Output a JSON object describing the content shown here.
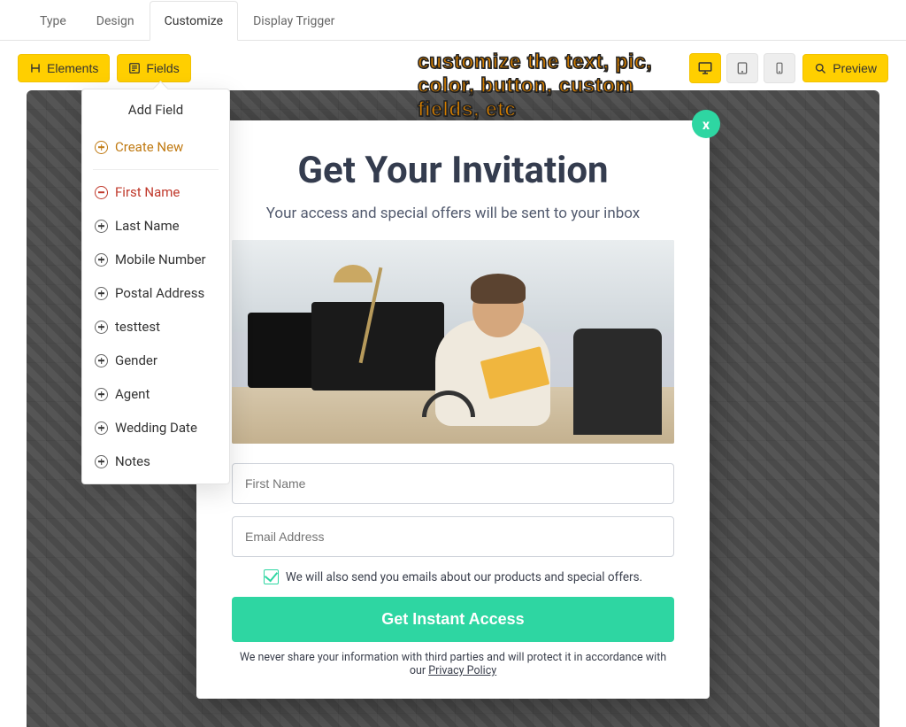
{
  "tabs": {
    "type": "Type",
    "design": "Design",
    "customize": "Customize",
    "display_trigger": "Display Trigger"
  },
  "toolbar": {
    "elements": "Elements",
    "fields": "Fields",
    "preview": "Preview"
  },
  "annotation": "customize the text, pic, color, button, custom fields, etc",
  "dropdown": {
    "title": "Add Field",
    "create_new": "Create New",
    "items": [
      {
        "label": "First Name",
        "mode": "remove"
      },
      {
        "label": "Last Name",
        "mode": "add"
      },
      {
        "label": "Mobile Number",
        "mode": "add"
      },
      {
        "label": "Postal Address",
        "mode": "add"
      },
      {
        "label": "testtest",
        "mode": "add"
      },
      {
        "label": "Gender",
        "mode": "add"
      },
      {
        "label": "Agent",
        "mode": "add"
      },
      {
        "label": "Wedding Date",
        "mode": "add"
      },
      {
        "label": "Notes",
        "mode": "add"
      }
    ]
  },
  "popup": {
    "close": "x",
    "title": "Get Your Invitation",
    "subtitle": "Your access and special offers will be sent to your inbox",
    "first_name_placeholder": "First Name",
    "email_placeholder": "Email Address",
    "checkbox_label": "We will also send you emails about our products and special offers.",
    "cta": "Get Instant Access",
    "privacy_prefix": "We never share your information with third parties and will protect it in accordance with our ",
    "privacy_link": "Privacy Policy"
  },
  "colors": {
    "accent_yellow": "#ffcf00",
    "accent_teal": "#2ed6a2",
    "heading": "#343c4e"
  }
}
